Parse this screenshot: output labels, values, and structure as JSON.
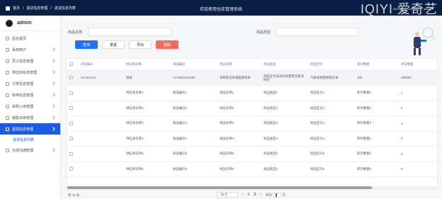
{
  "topbar": {
    "breadcrumb": [
      "首页",
      "退货信息管理",
      "退货信息列表"
    ],
    "app_title": "欢迎使用仓库管理系统",
    "logo_text": "IQIYI 爱奇艺",
    "datetime": "2024-04-17 15:52:19",
    "user_menu": "admin ▾"
  },
  "sidebar": {
    "username": "admin",
    "items": [
      {
        "label": "后台首页",
        "icon": "home-icon"
      },
      {
        "label": "系统用户",
        "icon": "user-icon"
      },
      {
        "label": "员工信息管理",
        "icon": "id-card-icon"
      },
      {
        "label": "供应商信息管理",
        "icon": "truck-icon"
      },
      {
        "label": "订单信息管理",
        "icon": "order-icon"
      },
      {
        "label": "库存信息管理",
        "icon": "box-icon"
      },
      {
        "label": "采购入库管理",
        "icon": "inbox-icon"
      },
      {
        "label": "销售出库管理",
        "icon": "outbox-icon"
      },
      {
        "label": "退货信息管理",
        "icon": "return-icon"
      },
      {
        "label": "在线沟通管理",
        "icon": "chat-icon"
      }
    ],
    "active_index": 8,
    "submenu_label": "退货信息列表"
  },
  "filters": {
    "product_name_label": "商品名称",
    "product_type_label": "商品类型"
  },
  "buttons": {
    "search": "查询",
    "reset": "重置",
    "export": "导出",
    "delete": "删除"
  },
  "table": {
    "headers": [
      "退货编号",
      "供应商名称",
      "商品编号",
      "商品名称",
      "商品类型",
      "商品型号",
      "库存数量",
      "退货数量"
    ],
    "rows": [
      [
        "12-121212",
        "测试",
        "1712821541467",
        "华硕笔记本电脑游戏本",
        "华硕五代未开封未使用全新未拆封",
        "气质高端游戏笔记本",
        "200",
        "300000"
      ],
      [
        "",
        "供应商名称1",
        "商品编号1",
        "商品名称1",
        "商品类型1",
        "商品型号1",
        "库存数量1",
        "1"
      ],
      [
        "",
        "供应商名称2",
        "商品编号2",
        "商品名称2",
        "商品类型2",
        "商品型号2",
        "库存数量2",
        "2"
      ],
      [
        "",
        "供应商名称3",
        "商品编号3",
        "商品名称3",
        "商品类型3",
        "商品型号3",
        "库存数量3",
        "3"
      ],
      [
        "",
        "供应商名称4",
        "商品编号4",
        "商品名称4",
        "商品类型4",
        "商品型号4",
        "库存数量4",
        "4"
      ],
      [
        "",
        "供应商名称5",
        "商品编号5",
        "商品名称5",
        "商品类型5",
        "商品型号5",
        "库存数量5",
        "5"
      ],
      [
        "",
        "供应商名称6",
        "商品编号6",
        "商品名称6",
        "商品类型6",
        "商品型号6",
        "库存数量6",
        "6"
      ]
    ]
  },
  "footer": {
    "total": "共 12 条",
    "page_size": "7条/页",
    "pages": [
      "1",
      "2"
    ],
    "current_page": "2",
    "goto_label": "前往",
    "goto_value": "1",
    "page_suffix": "页"
  },
  "colors": {
    "topbar": "#0a1f45",
    "accent": "#1d5be7",
    "danger": "#f26b5b"
  }
}
